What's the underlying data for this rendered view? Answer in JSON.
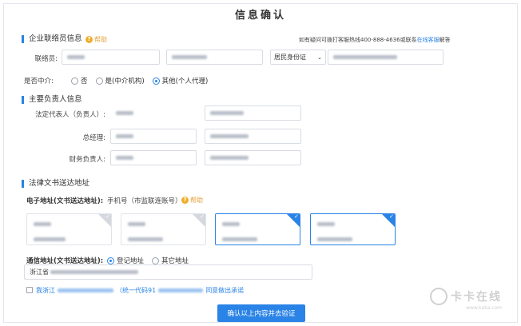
{
  "page": {
    "title": "信息确认"
  },
  "contact_section": {
    "title": "企业联络员信息",
    "help_label": "帮助",
    "hotline_prefix": "如有疑问可拨打客服热线400-888-4636或联系",
    "hotline_link": "在线客服",
    "hotline_suffix": "解答",
    "contact_label": "联络员:",
    "id_type_selected": "居民身份证",
    "intermediary_label": "是否中介:",
    "intermediary_options": [
      "否",
      "是(中介机构)",
      "其他(个人代理)"
    ],
    "intermediary_selected": 2
  },
  "principal_section": {
    "title": "主要负责人信息",
    "rows": [
      {
        "label": "法定代表人（负责人）:"
      },
      {
        "label": "总经理:"
      },
      {
        "label": "财务负责人:"
      }
    ]
  },
  "legal_section": {
    "title": "法律文书送达地址",
    "electronic_label": "电子地址(文书送达地址):",
    "electronic_hint": "手机号（市监联连账号）",
    "help_label": "帮助",
    "cards": [
      {
        "selected": false
      },
      {
        "selected": false
      },
      {
        "selected": true
      },
      {
        "selected": true
      }
    ],
    "postal_label": "通信地址(文书送达地址):",
    "postal_options": [
      "登记地址",
      "其它地址"
    ],
    "postal_selected": 0,
    "address_value": "浙江省",
    "promise_start": "我浙江",
    "promise_middle": "（统一代码91",
    "promise_end": "同意做出承诺"
  },
  "submit_label": "确认以上内容并去验证",
  "watermark": {
    "text": "卡卡在线",
    "url": "www.kaka.com"
  }
}
